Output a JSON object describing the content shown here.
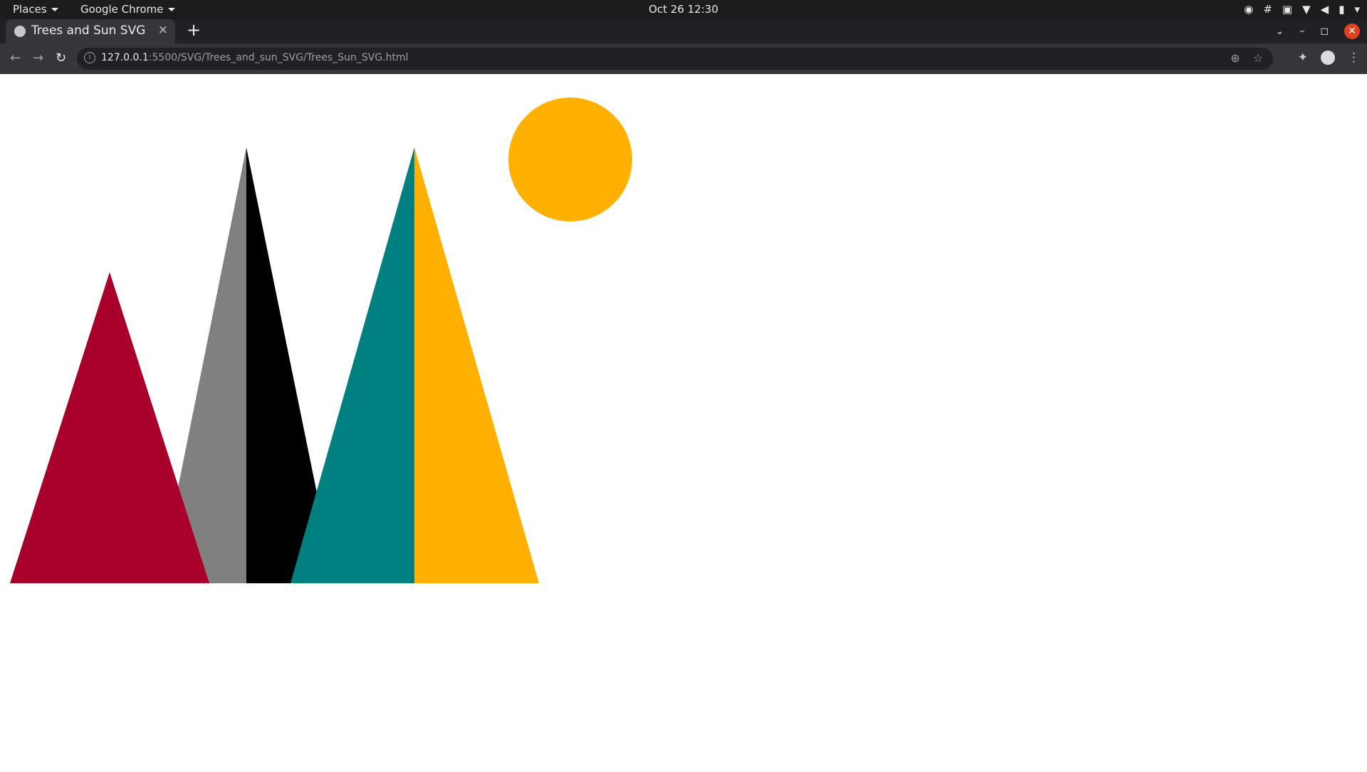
{
  "system_bar": {
    "places_label": "Places",
    "app_label": "Google Chrome",
    "clock": "Oct 26  12:30",
    "tray_icons": [
      "discord-icon",
      "slack-icon",
      "zoom-icon",
      "wifi-icon",
      "volume-icon",
      "battery-icon",
      "chevron-down-icon"
    ]
  },
  "browser": {
    "tab_title": "Trees and Sun SVG",
    "new_tab_symbol": "+",
    "close_tab_symbol": "×",
    "url_host": "127.0.0.1",
    "url_rest": ":5500/SVG/Trees_and_sun_SVG/Trees_Sun_SVG.html"
  },
  "scene": {
    "colors": {
      "red_tree": "#a8002a",
      "gray": "#808080",
      "black": "#000000",
      "teal": "#008080",
      "yellow": "#ffb000",
      "sun": "#ffb000"
    }
  }
}
